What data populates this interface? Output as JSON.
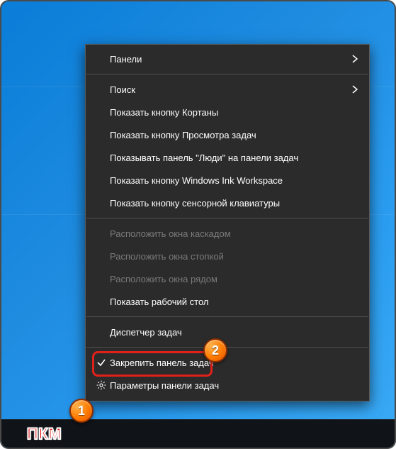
{
  "menu": {
    "items": [
      {
        "label": "Панели",
        "submenu": true
      },
      {
        "separator": true
      },
      {
        "label": "Поиск",
        "submenu": true
      },
      {
        "label": "Показать кнопку Кортаны"
      },
      {
        "label": "Показать кнопку Просмотра задач"
      },
      {
        "label": "Показывать панель \"Люди\" на панели задач"
      },
      {
        "label": "Показать кнопку Windows Ink Workspace"
      },
      {
        "label": "Показать кнопку сенсорной клавиатуры"
      },
      {
        "separator": true
      },
      {
        "label": "Расположить окна каскадом",
        "disabled": true
      },
      {
        "label": "Расположить окна стопкой",
        "disabled": true
      },
      {
        "label": "Расположить окна рядом",
        "disabled": true
      },
      {
        "label": "Показать рабочий стол"
      },
      {
        "separator": true
      },
      {
        "label": "Диспетчер задач",
        "highlighted": true
      },
      {
        "separator": true
      },
      {
        "label": "Закрепить панель задач",
        "checked": true
      },
      {
        "label": "Параметры панели задач",
        "gear": true
      }
    ]
  },
  "annotations": {
    "callout1": "1",
    "callout2": "2",
    "pkm": "ПКМ"
  },
  "colors": {
    "menu_bg": "#2b2b2b",
    "menu_border": "#5a5a5a",
    "disabled_text": "#7a7a7a",
    "highlight_border": "#e0211a",
    "callout_fill": "#ff7a00",
    "pkm_color": "#e01616",
    "taskbar": "#101317"
  }
}
